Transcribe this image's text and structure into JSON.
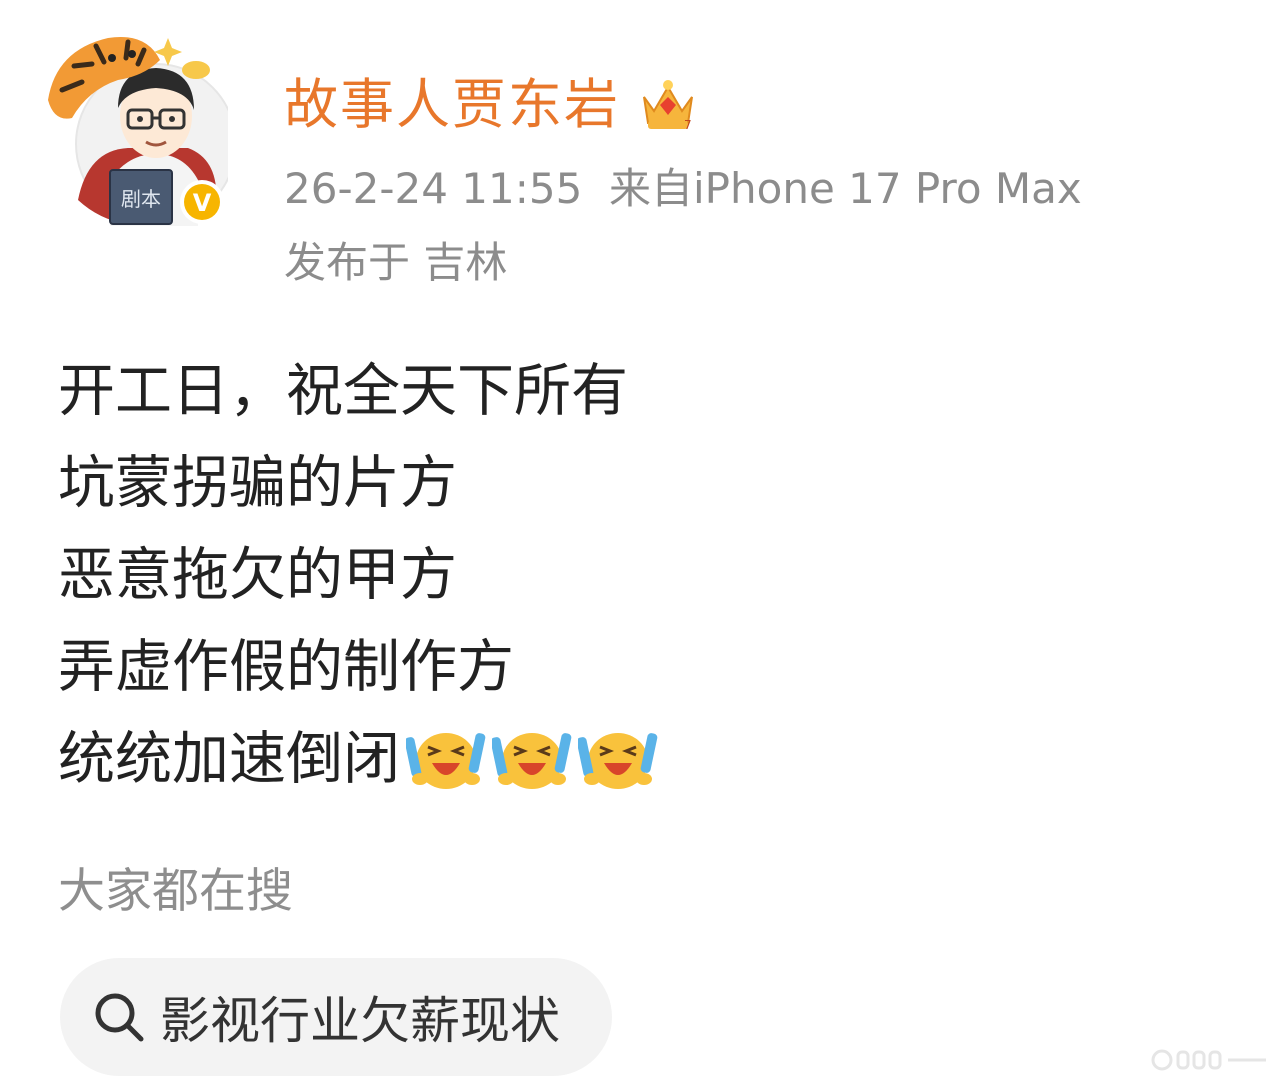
{
  "post": {
    "author": {
      "name": "故事人贾东岩",
      "avatar_book_label": "剧本",
      "avatar_icon": "cartoon-writer-with-tiger-avatar",
      "verified_badge_icon": "v-badge-icon",
      "crown_icon": "crown-icon",
      "verified_badge_letter": "V"
    },
    "meta": {
      "time": "26-2-24 11:55",
      "source": "来自iPhone 17 Pro Max",
      "location": "发布于 吉林"
    },
    "lines": [
      "开工日，祝全天下所有",
      "坑蒙拐骗的片方",
      "恶意拖欠的甲方",
      "弄虚作假的制作方",
      "统统加速倒闭"
    ],
    "trailing_emoji": [
      "laughing-crying-face-icon",
      "laughing-crying-face-icon",
      "laughing-crying-face-icon"
    ]
  },
  "trending": {
    "label": "大家都在搜",
    "query": "影视行业欠薪现状"
  },
  "colors": {
    "username": "#e8772b",
    "meta": "#8c8c8c",
    "body_text": "#222222",
    "chip_bg": "#f3f3f3",
    "badge": "#f7b500"
  }
}
